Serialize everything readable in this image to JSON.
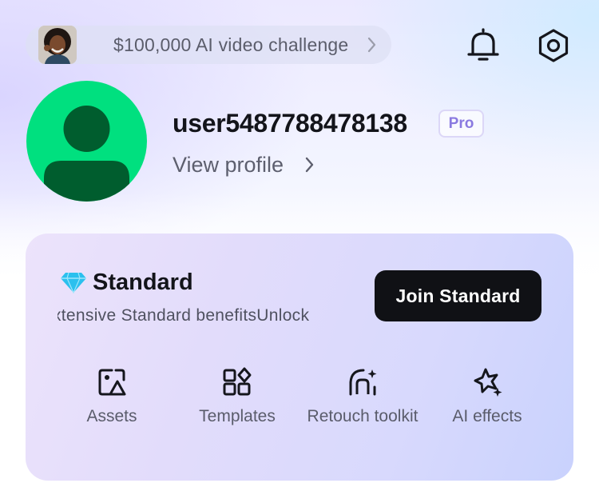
{
  "challenge": {
    "label": "$100,000 AI video challenge",
    "thumbnail_icon": "challenge-portrait-thumbnail",
    "chevron_icon": "chevron-right-icon"
  },
  "header": {
    "notifications_icon": "bell-icon",
    "settings_icon": "gear-hexagon-icon"
  },
  "profile": {
    "username": "user5487788478138",
    "badge": "Pro",
    "view_profile_label": "View profile",
    "avatar_icon": "default-user-avatar"
  },
  "membership": {
    "plan_name": "Standard",
    "plan_icon": "diamond-icon",
    "benefits_text": "xtensive Standard benefitsUnlock",
    "join_button_label": "Join Standard",
    "tools": [
      {
        "label": "Assets",
        "icon": "assets-image-icon"
      },
      {
        "label": "Templates",
        "icon": "templates-grid-icon"
      },
      {
        "label": "Retouch toolkit",
        "icon": "retouch-face-icon"
      },
      {
        "label": "AI effects",
        "icon": "ai-effects-sparkle-icon"
      }
    ]
  },
  "colors": {
    "avatar_background": "#00e07f",
    "avatar_figure": "#005d2e",
    "diamond": "#2bc0ee",
    "pro_badge_text": "#8a7ae0",
    "join_button": "#101115",
    "card_gradient_start": "#ece3fb",
    "card_gradient_end": "#c9d2fd"
  }
}
